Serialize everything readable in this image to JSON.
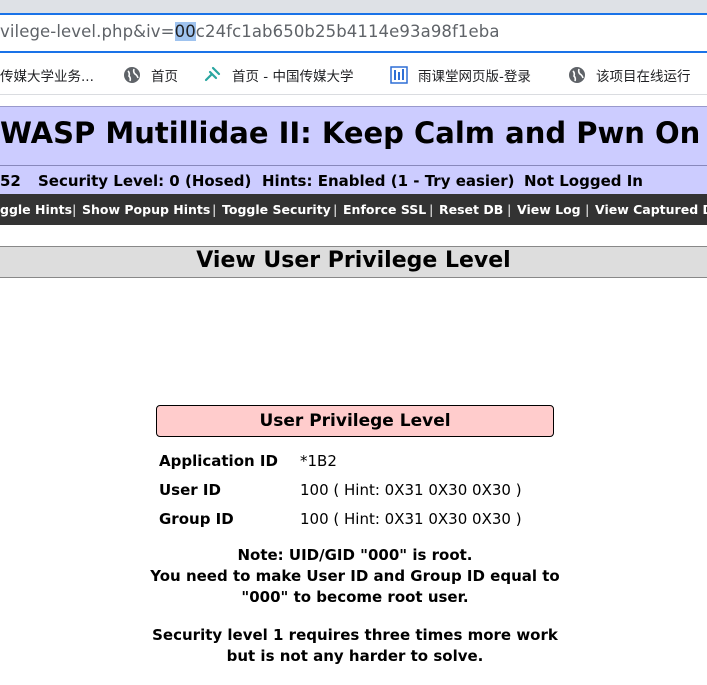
{
  "browser": {
    "url_prefix": "vilege-level.php&iv=",
    "url_selected": "00",
    "url_suffix": "c24fc1ab650b25b4114e93a98f1eba",
    "bookmarks": [
      {
        "label": "传媒大学业务...",
        "icon": "none"
      },
      {
        "label": "首页",
        "icon": "globe-icon"
      },
      {
        "label": "首页 - 中国传媒大学",
        "icon": "link-icon"
      },
      {
        "label": "雨课堂网页版-登录",
        "icon": "rain-classroom-icon"
      },
      {
        "label": "该项目在线运行",
        "icon": "globe-icon"
      }
    ]
  },
  "site": {
    "title": "WASP Mutillidae II: Keep Calm and Pwn On",
    "status": {
      "version": "52",
      "security_level": "Security Level: 0 (Hosed)",
      "hints": "Hints: Enabled (1 - Try easier)",
      "login": "Not Logged In"
    },
    "menu": [
      "ggle Hints",
      "Show Popup Hints",
      "Toggle Security",
      "Enforce SSL",
      "Reset DB",
      "View Log",
      "View Captured D"
    ]
  },
  "main": {
    "heading": "View User Privilege Level",
    "panel_title": "User Privilege Level",
    "rows": [
      {
        "label": "Application ID",
        "value": "*1B2"
      },
      {
        "label": "User ID",
        "value": "100 ( Hint: 0X31 0X30 0X30 )"
      },
      {
        "label": "Group ID",
        "value": "100 ( Hint: 0X31 0X30 0X30 )"
      }
    ],
    "note_lines": [
      "Note: UID/GID \"000\" is root.",
      "You need to make User ID and Group ID equal to",
      "\"000\" to become root user."
    ],
    "security_note_lines": [
      "Security level 1 requires three times more work",
      "but is not any harder to solve."
    ]
  },
  "colors": {
    "header_bg": "#ccccff",
    "menu_bg": "#333333",
    "panel_title_bg": "#ffcccc",
    "selection": "#9fc3ef"
  }
}
